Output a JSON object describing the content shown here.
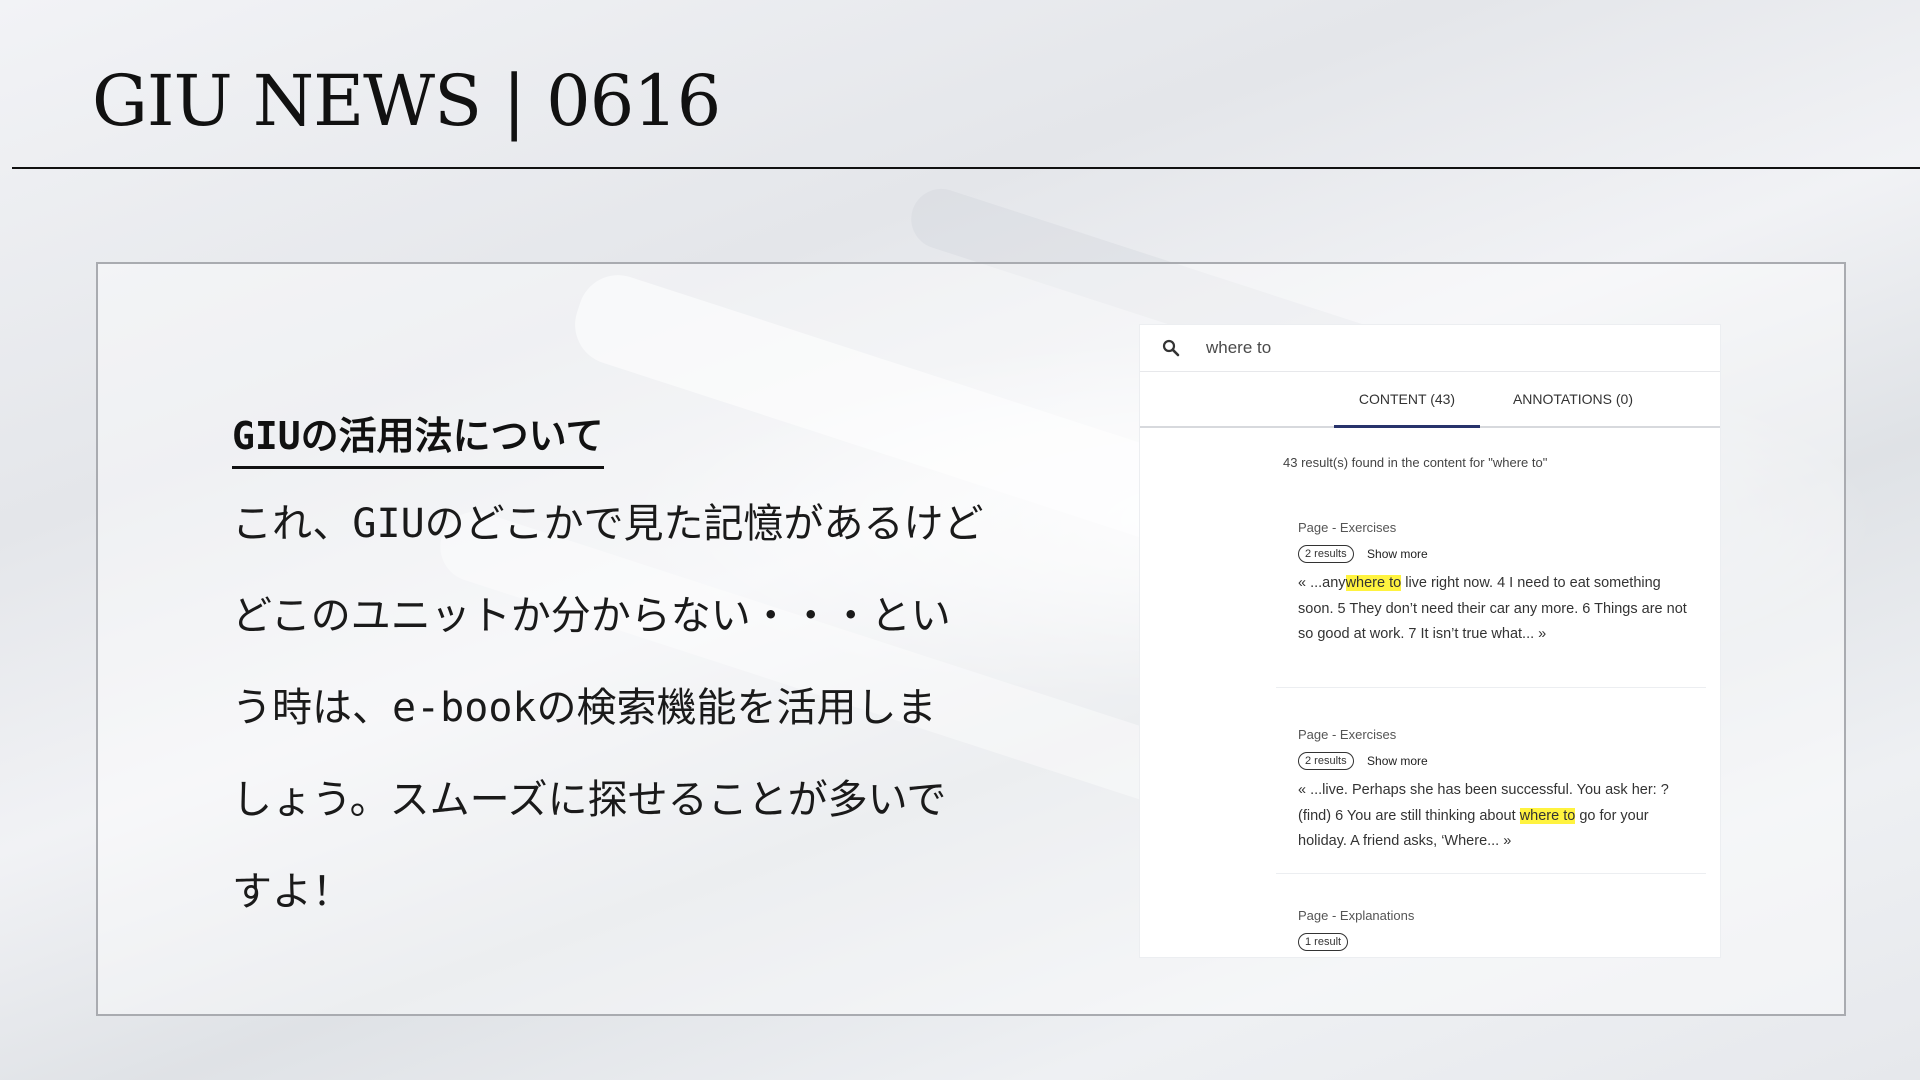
{
  "slide": {
    "title": "GIU NEWS | 0616"
  },
  "article": {
    "heading": "GIUの活用法について",
    "lines": [
      "これ、GIUのどこかで見た記憶があるけど",
      "どこのユニットか分からない・・・とい",
      "う時は、e-bookの検索機能を活用しま",
      "しょう。スムーズに探せることが多いで",
      "すよ！"
    ]
  },
  "ebook": {
    "search": {
      "icon": "search-icon",
      "value": "where to"
    },
    "tabs": [
      {
        "label": "CONTENT (43)",
        "active": true
      },
      {
        "label": "ANNOTATIONS (0)",
        "active": false
      }
    ],
    "summary": "43 result(s) found in the content for \"where to\"",
    "results": [
      {
        "type": "Page - Exercises",
        "count": "2 results",
        "show_more": "Show more",
        "snippet_before": "« ...any",
        "highlight": "where to",
        "snippet_after": " live right now. 4 I need to eat something soon. 5 They don’t need their car any more. 6 Things are not so good at work. 7 It isn’t true what... »"
      },
      {
        "type": "Page - Exercises",
        "count": "2 results",
        "show_more": "Show more",
        "snippet_before": "« ...live.  Perhaps she has been successful. You ask her: ?  (find) 6 You are still thinking about ",
        "highlight": "where to",
        "snippet_after": " go for your holiday.  A friend asks, ‘Where... »"
      },
      {
        "type": "Page - Explanations",
        "count": "1 result"
      }
    ],
    "colors": {
      "highlight": "#fff33f",
      "active_tab": "#27336b"
    }
  }
}
